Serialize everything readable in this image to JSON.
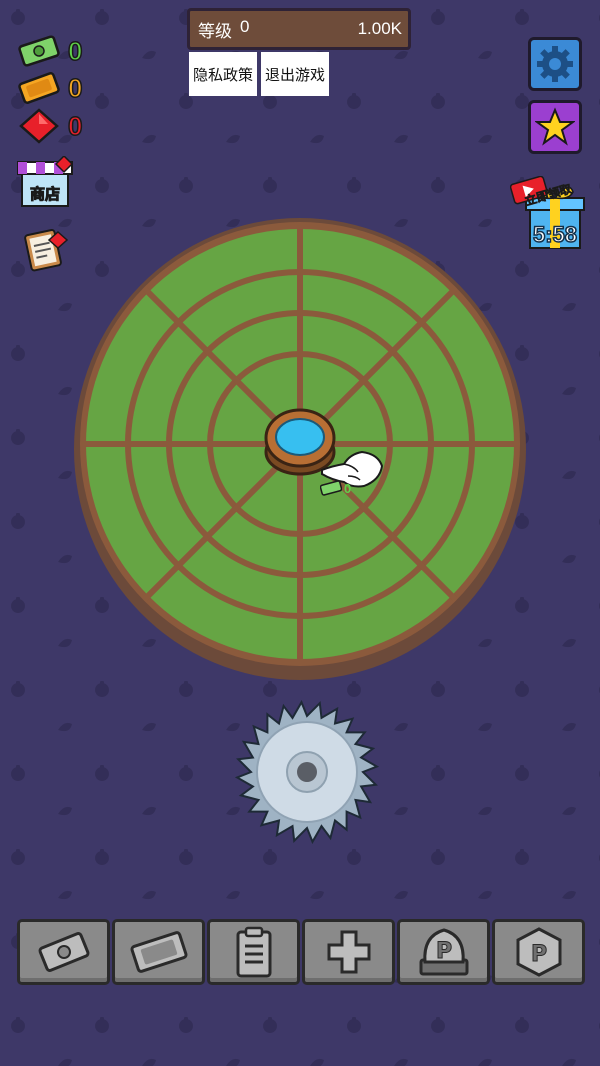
{
  "header": {
    "level_label": "等级",
    "level_value": "0",
    "money_total": "1.00K"
  },
  "buttons": {
    "privacy": "隐私政策",
    "exit": "退出游戏"
  },
  "currencies": {
    "cash": "0",
    "tickets": "0",
    "gems": "0"
  },
  "colors": {
    "cash": "#5fd14a",
    "tickets": "#f4a623",
    "gems": "#e8202a"
  },
  "shop": {
    "label": "商店"
  },
  "gift": {
    "label": "立即领取",
    "timer": "5:58"
  },
  "field": {
    "coin_value": "0"
  },
  "toolbar": {
    "icons": [
      "cash-icon",
      "ticket-icon",
      "clipboard-icon",
      "plus-icon",
      "p-stone-icon",
      "p-hexagon-icon"
    ]
  }
}
